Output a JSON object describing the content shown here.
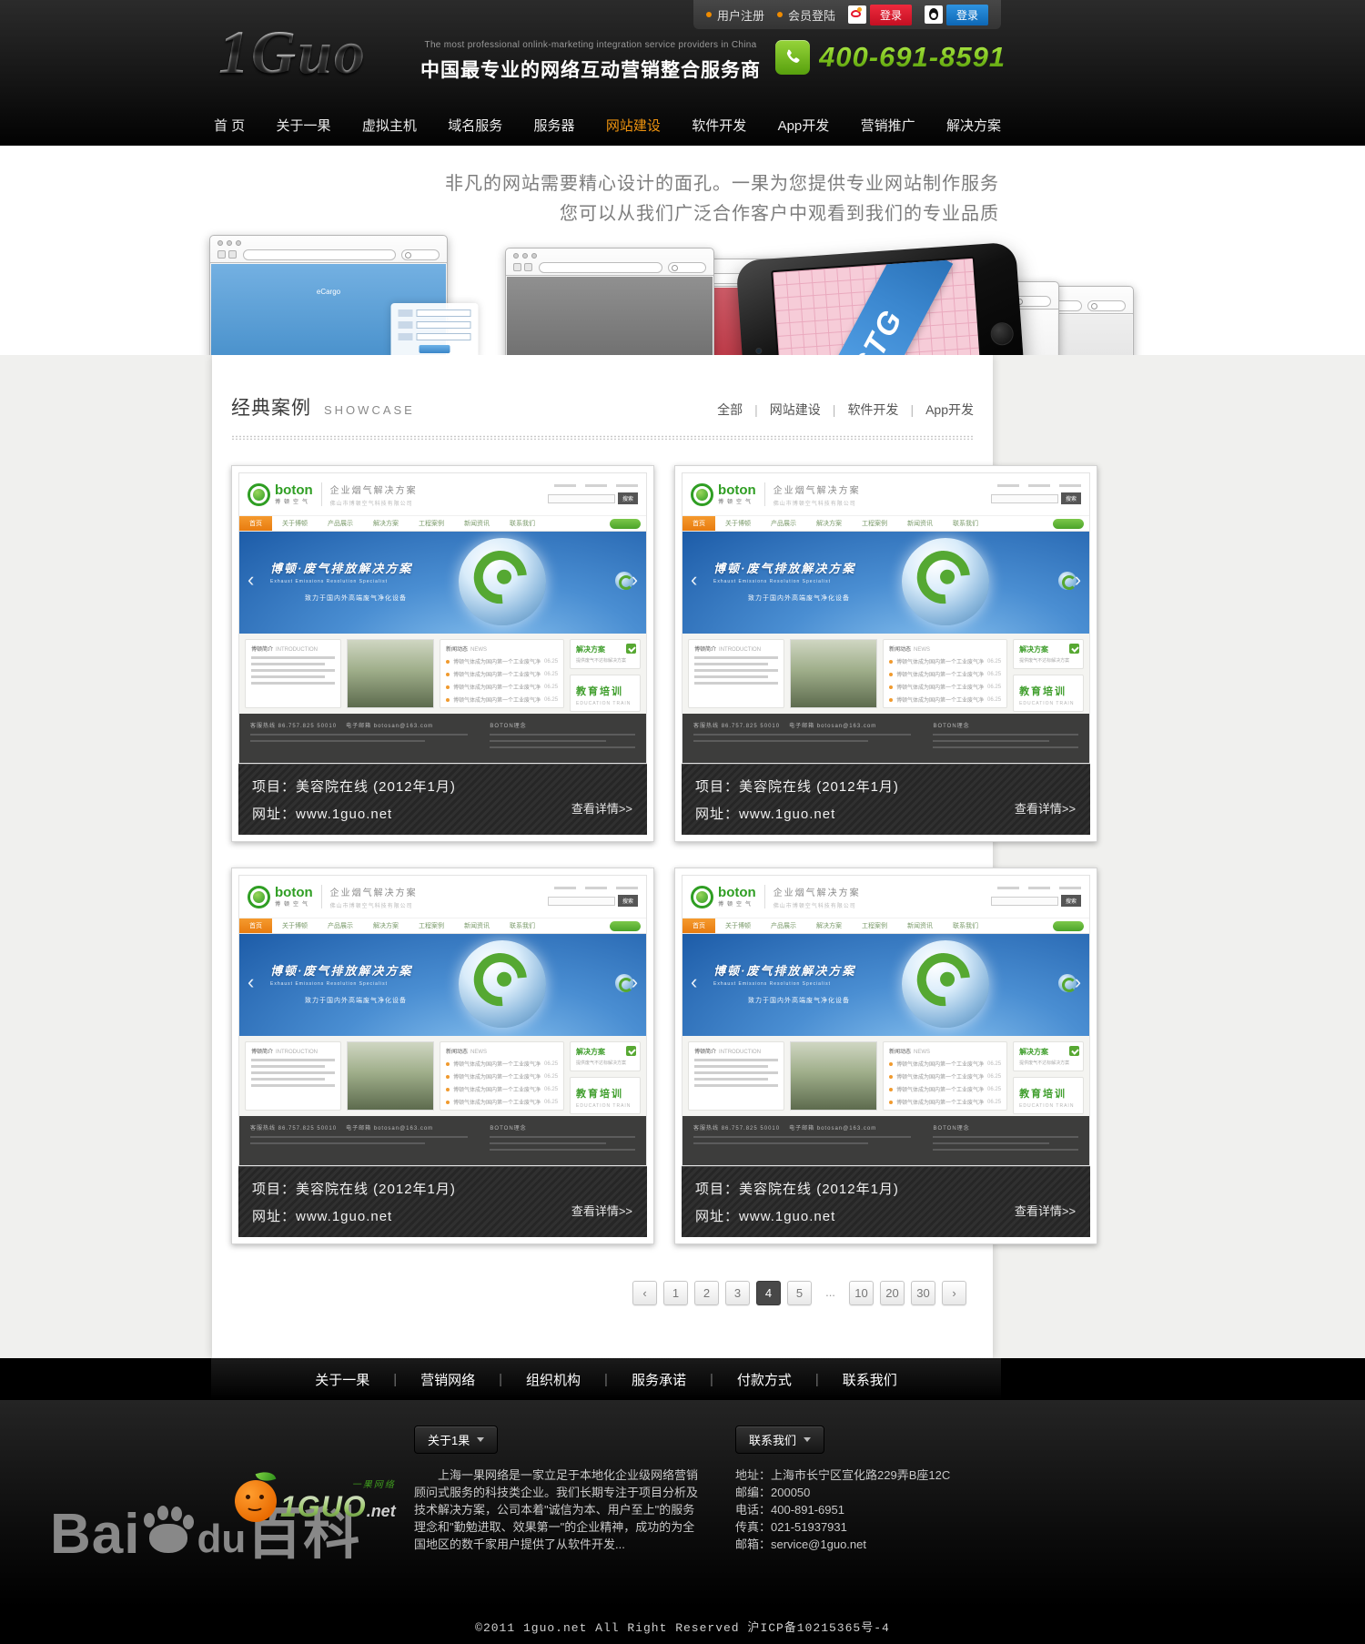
{
  "topbar": {
    "register": "用户注册",
    "member_login": "会员登陆",
    "weibo_login_label": "登录",
    "qq_login_label": "登录"
  },
  "header": {
    "logo_text": "1Guo",
    "tagline_en": "The most professional onlink-marketing integration service providers in China",
    "tagline_cn": "中国最专业的网络互动营销整合服务商",
    "phone_number": "400-691-8591",
    "accent_orange": "#ef8b00",
    "phone_green": "#7cc21c"
  },
  "nav": {
    "items": [
      {
        "label": "首 页",
        "active": false
      },
      {
        "label": "关于一果",
        "active": false
      },
      {
        "label": "虚拟主机",
        "active": false
      },
      {
        "label": "域名服务",
        "active": false
      },
      {
        "label": "服务器",
        "active": false
      },
      {
        "label": "网站建设",
        "active": true
      },
      {
        "label": "软件开发",
        "active": false
      },
      {
        "label": "App开发",
        "active": false
      },
      {
        "label": "营销推广",
        "active": false
      },
      {
        "label": "解决方案",
        "active": false
      }
    ]
  },
  "hero": {
    "line1": "非凡的网站需要精心设计的面孔。一果为您提供专业网站制作服务",
    "line2": "您可以从我们广泛合作客户中观看到我们的专业品质",
    "app_label": "eCargo",
    "phone_ribbon_text": "STG",
    "slides": [
      {
        "color": "#4596d8"
      },
      {
        "color": "#6b6b6b"
      },
      {
        "color": "#c12737"
      },
      {
        "color": "#9aa36b"
      },
      {
        "color": "#f4f4f4"
      },
      {
        "color": "#fafafa"
      },
      {
        "color": "#e9e9e9"
      }
    ]
  },
  "showcase": {
    "title_cn": "经典案例",
    "title_en": "SHOWCASE",
    "filters": [
      "全部",
      "网站建设",
      "软件开发",
      "App开发"
    ],
    "projects": [
      {
        "title": "项目：美容院在线 (2012年1月)",
        "url": "网址：www.1guo.net",
        "detail": "查看详情>>"
      },
      {
        "title": "项目：美容院在线 (2012年1月)",
        "url": "网址：www.1guo.net",
        "detail": "查看详情>>"
      },
      {
        "title": "项目：美容院在线 (2012年1月)",
        "url": "网址：www.1guo.net",
        "detail": "查看详情>>"
      },
      {
        "title": "项目：美容院在线 (2012年1月)",
        "url": "网址：www.1guo.net",
        "detail": "查看详情>>"
      }
    ],
    "minisite": {
      "logo_text": "boton",
      "logo_sub": "博顿空气",
      "slogan": "企业烟气解决方案",
      "company": "佛山市博顿空气科技有限公司",
      "topnav": [
        "首页",
        "关于博顿",
        "产品展示",
        "解决方案",
        "工程案例",
        "新闻资讯",
        "联系我们"
      ],
      "search_label": "搜索",
      "banner_title": "博顿·废气排放解决方案",
      "banner_sub": "Exhaust Emissions Resolution Specialist",
      "banner_note": "致力于国内外高端废气净化设备",
      "intro_cn": "博顿简介",
      "intro_en": "INTRODUCTION",
      "news_cn": "新闻动态",
      "news_en": "NEWS",
      "news_items": [
        {
          "text": "博顿气体成为国内第一个工业废气净",
          "date": "06.25"
        },
        {
          "text": "博顿气体成为国内第一个工业废气净",
          "date": "06.25"
        },
        {
          "text": "博顿气体成为国内第一个工业废气净",
          "date": "06.25"
        },
        {
          "text": "博顿气体成为国内第一个工业废气净",
          "date": "06.25"
        }
      ],
      "solution_title": "解决方案",
      "solution_sub": "提供废气不达标解决方案",
      "training_title": "教育培训",
      "training_sub": "EDUCATION TRAIN",
      "footer_hotline": "客服热线 86.757.825 50010",
      "footer_email": "电子邮箱 botosan@163.com",
      "footer_right_title": "BOTON理念"
    },
    "pagination": {
      "prev": "‹",
      "items": [
        {
          "label": "1"
        },
        {
          "label": "2"
        },
        {
          "label": "3"
        },
        {
          "label": "4",
          "active": true
        },
        {
          "label": "5"
        },
        {
          "label": "...",
          "plain": true
        },
        {
          "label": "10"
        },
        {
          "label": "20"
        },
        {
          "label": "30"
        }
      ],
      "next": "›"
    }
  },
  "footer": {
    "nav": [
      "关于一果",
      "营销网络",
      "组织机构",
      "服务承诺",
      "付款方式",
      "联系我们"
    ],
    "about_button": "关于1果",
    "about_text": "上海一果网络是一家立足于本地化企业级网络营销顾问式服务的科技类企业。我们长期专注于项目分析及技术解决方案，公司本着\"诚信为本、用户至上\"的服务理念和\"勤勉进取、效果第一\"的企业精神，成功的为全国地区的数千家用户提供了从软件开发...",
    "contact_button": "联系我们",
    "contact_lines": [
      "地址：上海市长宁区宣化路229弄B座12C",
      "邮编：200050",
      "电话：400-891-6951",
      "传真：021-51937931",
      "邮箱：service@1guo.net"
    ],
    "watermark": {
      "part1": "Bai",
      "part2": "du",
      "part3": "百科"
    },
    "logo_cn": "一果网络",
    "logo_main": "1GUO",
    "logo_suffix": ".net",
    "copyright": "©2011 1guo.net All Right Reserved 沪ICP备10215365号-4"
  }
}
